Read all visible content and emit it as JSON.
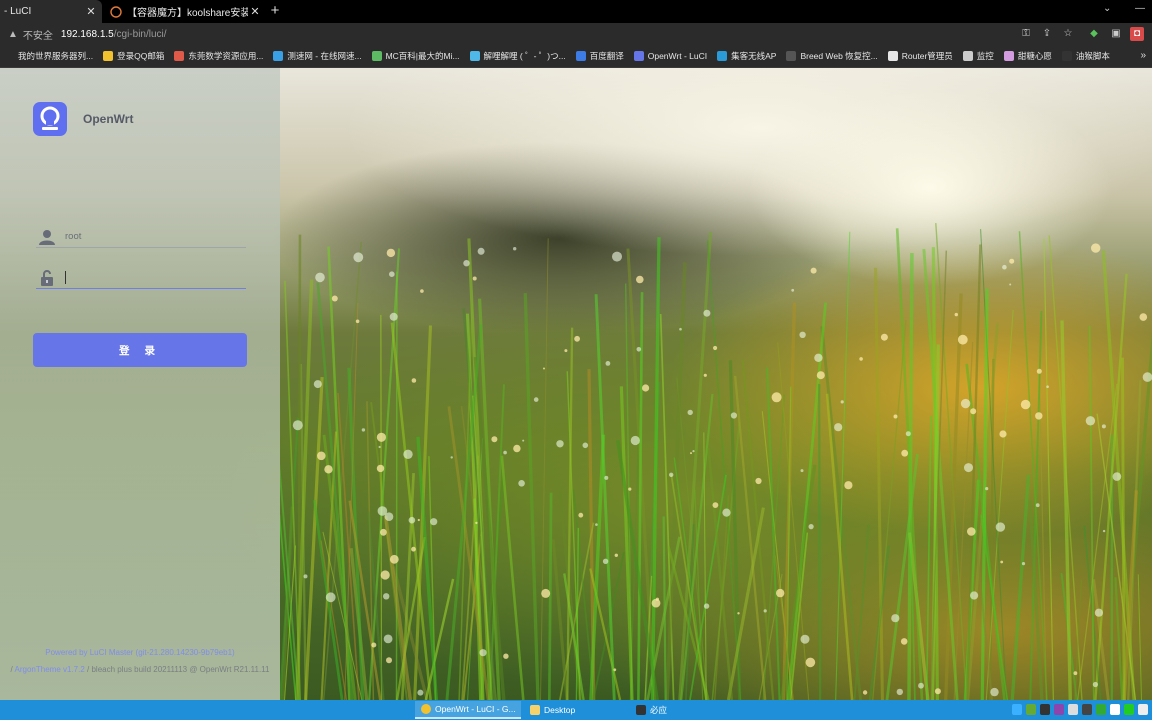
{
  "browser": {
    "tabs": [
      {
        "title": "- LuCI",
        "close": "✕"
      },
      {
        "title": "【容器魔方】koolshare安装游…",
        "close": "✕"
      }
    ],
    "new_tab": "+",
    "address": {
      "security_label": "不安全",
      "host": "192.168.1.5",
      "path": "/cgi-bin/luci/"
    },
    "bookmarks": [
      {
        "label": "我的世界服务器列...",
        "color": "#2b2b2b"
      },
      {
        "label": "登录QQ邮箱",
        "color": "#f2c12e"
      },
      {
        "label": "东莞数学资源应用...",
        "color": "#e05a4a"
      },
      {
        "label": "测速网 - 在线网速...",
        "color": "#3aa0e6"
      },
      {
        "label": "MC百科|最大的Mi...",
        "color": "#5dbb63"
      },
      {
        "label": "解哩解哩 ( ゜- ゜)つ...",
        "color": "#4fb8e8"
      },
      {
        "label": "百度翻译",
        "color": "#3d7be6"
      },
      {
        "label": "OpenWrt - LuCI",
        "color": "#6675e8"
      },
      {
        "label": "集客无线AP",
        "color": "#2a9ad8"
      },
      {
        "label": "Breed Web 恢复控...",
        "color": "#555555"
      },
      {
        "label": "Router管理员",
        "color": "#e6e6e6"
      },
      {
        "label": "监控",
        "color": "#cccccc"
      },
      {
        "label": "甜糖心愿",
        "color": "#d49be0"
      },
      {
        "label": "油猴脚本",
        "color": "#333333"
      }
    ],
    "bookmarks_more": "»"
  },
  "login": {
    "brand": "OpenWrt",
    "username_value": "root",
    "password_value": "",
    "button_label": "登 录",
    "footer_line1": "Powered by LuCI Master (git-21.280.14230-9b79eb1)",
    "footer_line2_link": "ArgonTheme v1.7.2",
    "footer_line2_text": " / bleach plus build 20211113 @ OpenWrt R21.11.11",
    "footer_line2_prefix": "/ "
  },
  "taskbar": {
    "items": [
      {
        "label": "OpenWrt - LuCI - G..."
      },
      {
        "label": "Desktop"
      },
      {
        "label": "必应"
      }
    ]
  }
}
